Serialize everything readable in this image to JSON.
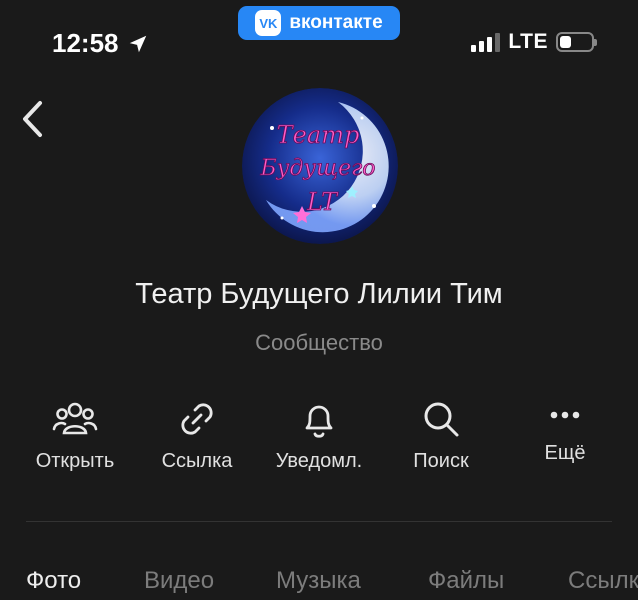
{
  "status": {
    "time": "12:58",
    "network": "LTE",
    "battery_level": 0.35,
    "signal_bars_active": 3
  },
  "vk_badge": {
    "text": "вконтакте",
    "logo_text": "VK"
  },
  "profile": {
    "avatar_text": [
      "Театр",
      "Будущего",
      "LT"
    ],
    "name": "Театр Будущего Лилии Тим",
    "type": "Сообщество"
  },
  "actions": [
    {
      "label": "Открыть",
      "icon": "people-icon"
    },
    {
      "label": "Ссылка",
      "icon": "link-icon"
    },
    {
      "label": "Уведомл.",
      "icon": "bell-icon"
    },
    {
      "label": "Поиск",
      "icon": "search-icon"
    },
    {
      "label": "Ещё",
      "icon": "more-dots-icon"
    }
  ],
  "tabs": [
    {
      "label": "Фото",
      "active": true
    },
    {
      "label": "Видео",
      "active": false
    },
    {
      "label": "Музыка",
      "active": false
    },
    {
      "label": "Файлы",
      "active": false
    },
    {
      "label": "Ссылки",
      "active": false
    }
  ],
  "colors": {
    "background": "#1a1a1a",
    "vk_blue": "#2787f5",
    "text_primary": "#f0f0f0",
    "text_secondary": "#8a8a8a"
  }
}
